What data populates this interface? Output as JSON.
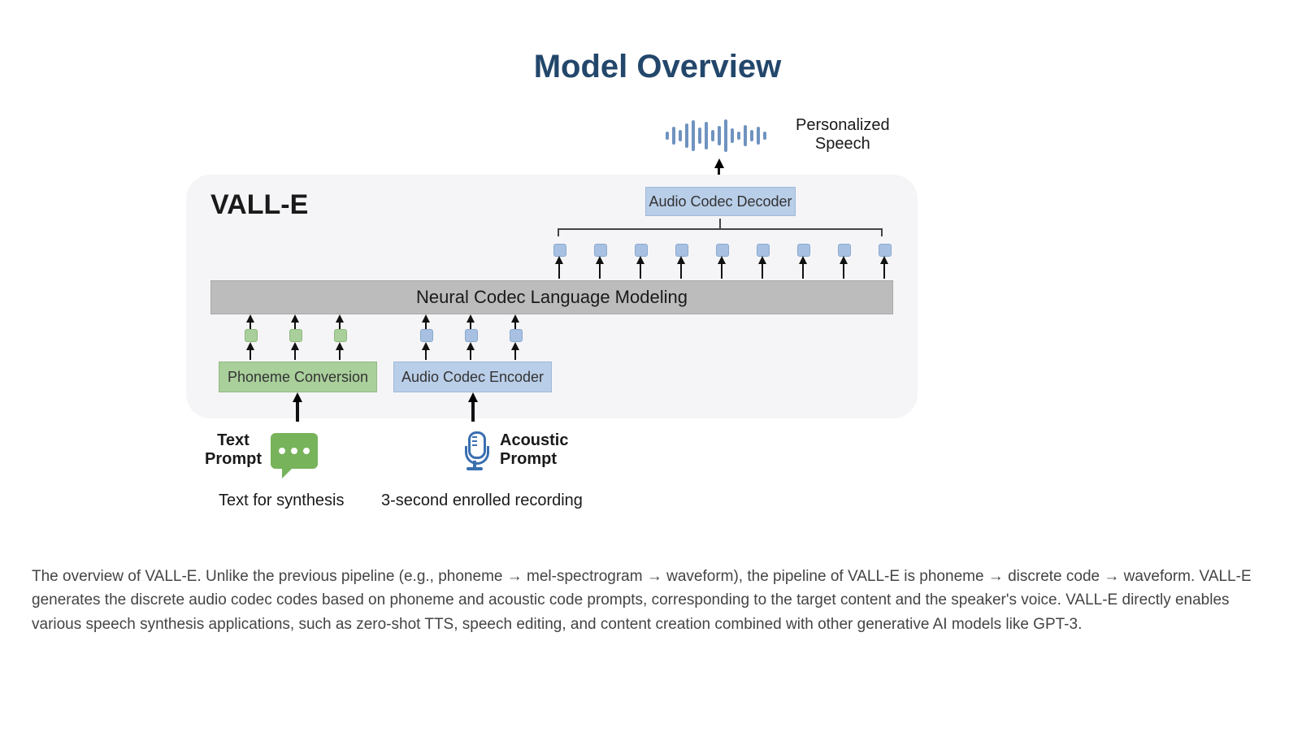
{
  "title": "Model Overview",
  "model_name": "VALL-E",
  "output_label": "Personalized\nSpeech",
  "blocks": {
    "decoder": "Audio Codec Decoder",
    "core": "Neural Codec Language Modeling",
    "phoneme": "Phoneme Conversion",
    "encoder": "Audio Codec Encoder"
  },
  "inputs": {
    "text_label": "Text\nPrompt",
    "text_sub": "Text for synthesis",
    "acoustic_label": "Acoustic\nPrompt",
    "acoustic_sub": "3-second enrolled recording"
  },
  "counts": {
    "output_tokens": 9,
    "phoneme_tokens": 3,
    "encoder_tokens": 3
  },
  "colors": {
    "blue_token": "#a8c1e2",
    "green_token": "#a9cf9b",
    "panel_bg": "#f5f5f7",
    "title": "#23476b",
    "wave": "#6f93c0",
    "bubble": "#77b35b",
    "mic": "#3a6fb0"
  },
  "caption": "The overview of VALL-E. Unlike the previous pipeline (e.g., phoneme → mel-spectrogram → waveform), the pipeline of VALL-E is phoneme → discrete code → waveform. VALL-E generates the discrete audio codec codes based on phoneme and acoustic code prompts, corresponding to the target content and the speaker's voice. VALL-E directly enables various speech synthesis applications, such as zero-shot TTS, speech editing, and content creation combined with other generative AI models like GPT-3."
}
